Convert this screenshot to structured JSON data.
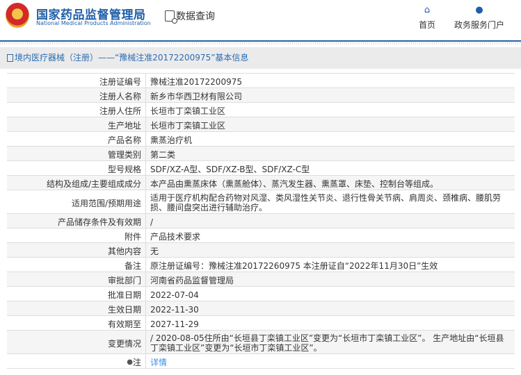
{
  "header": {
    "logo_cn": "国家药品监督管理局",
    "logo_en": "National Medical Products Administration",
    "data_query": "数据查询",
    "nav": [
      {
        "label": "首页",
        "icon": "home-icon"
      },
      {
        "label": "政务服务门户",
        "icon": "user-icon"
      }
    ]
  },
  "breadcrumb": "境内医疗器械（注册）——“豫械注准20172200975”基本信息",
  "rows": [
    {
      "k": "注册证编号",
      "v": "豫械注准20172200975"
    },
    {
      "k": "注册人名称",
      "v": "新乡市华西卫材有限公司"
    },
    {
      "k": "注册人住所",
      "v": "长垣市丁栾镇工业区"
    },
    {
      "k": "生产地址",
      "v": "长垣市丁栾镇工业区"
    },
    {
      "k": "产品名称",
      "v": "熏蒸治疗机"
    },
    {
      "k": "管理类别",
      "v": "第二类"
    },
    {
      "k": "型号规格",
      "v": "SDF/XZ-A型、SDF/XZ-B型、SDF/XZ-C型"
    },
    {
      "k": "结构及组成/主要组成成分",
      "v": "本产品由熏蒸床体（熏蒸舱体）、蒸汽发生器、熏蒸罩、床垫、控制台等组成。"
    },
    {
      "k": "适用范围/预期用途",
      "v": "适用于医疗机构配合药物对风湿、类风湿性关节炎、退行性骨关节病、肩周炎、颈椎病、腰肌劳损、腰间盘突出进行辅助治疗。"
    },
    {
      "k": "产品储存条件及有效期",
      "v": "/"
    },
    {
      "k": "附件",
      "v": "产品技术要求"
    },
    {
      "k": "其他内容",
      "v": "无"
    },
    {
      "k": "备注",
      "v": "原注册证编号：豫械注准20172260975 本注册证自“2022年11月30日”生效"
    },
    {
      "k": "审批部门",
      "v": "河南省药品监督管理局"
    },
    {
      "k": "批准日期",
      "v": "2022-07-04"
    },
    {
      "k": "生效日期",
      "v": "2022-11-30"
    },
    {
      "k": "有效期至",
      "v": "2027-11-29"
    },
    {
      "k": "变更情况",
      "v": " / 2020-08-05住所由“长垣县丁栾镇工业区”变更为“长垣市丁栾镇工业区”。 生产地址由“长垣县丁栾镇工业区”变更为“长垣市丁栾镇工业区”。"
    },
    {
      "k": "注",
      "v": "详情"
    }
  ]
}
